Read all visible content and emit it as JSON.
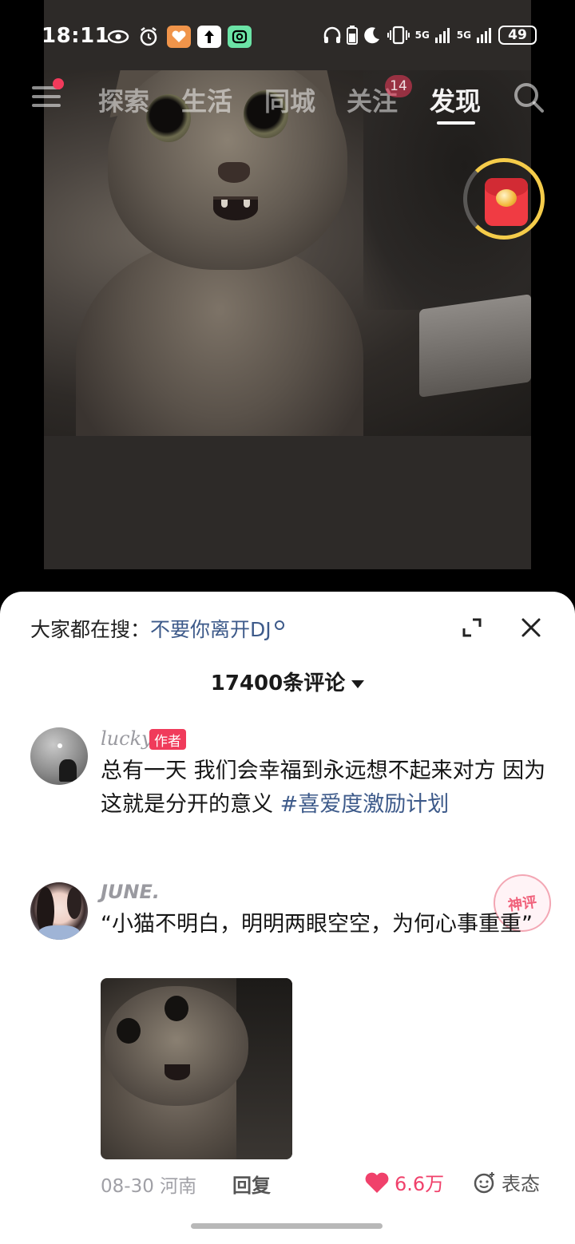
{
  "status_bar": {
    "time": "18:11",
    "battery": "49",
    "network_1": "5G",
    "network_2": "5G"
  },
  "top_tabs": {
    "items": [
      {
        "label": "探索"
      },
      {
        "label": "生活"
      },
      {
        "label": "同城"
      },
      {
        "label": "关注"
      },
      {
        "label": "发现"
      }
    ],
    "active": "发现",
    "follow_badge": "14"
  },
  "comment_sheet": {
    "search_prefix": "大家都在搜：",
    "search_term": "不要你离开DJ",
    "comment_count": "17400条评论",
    "comments": [
      {
        "username": "lucky",
        "tag": "作者",
        "text": "总有一天 我们会幸福到永远想不起来对方 因为这就是分开的意义 ",
        "hashtag": "#喜爱度激励计划"
      },
      {
        "username": "JUNE.",
        "stamp": "神评",
        "text": "“小猫不明白，明明两眼空空，为何心事重重”",
        "date_location": "08-30 河南",
        "reply_label": "回复",
        "likes": "6.6万",
        "react_label": "表态"
      }
    ]
  },
  "colors": {
    "accent_red": "#f03b5b",
    "link_blue": "#3d5a8a",
    "like_pink": "#f0416b"
  }
}
